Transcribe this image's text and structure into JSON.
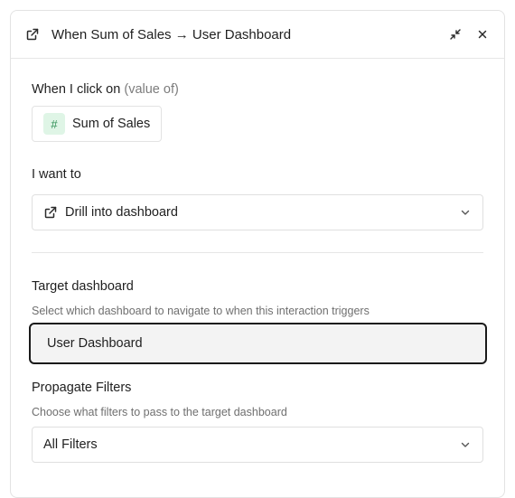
{
  "header": {
    "title": "When Sum of Sales → User Dashboard",
    "title_icon": "external-link-icon",
    "minimize_icon": "collapse-icon",
    "close_icon": "close-icon"
  },
  "trigger": {
    "label": "When I click on",
    "label_suffix": "(value of)",
    "chip_icon": "#",
    "chip_text": "Sum of Sales",
    "chip_color": "#dff5e6"
  },
  "action": {
    "label": "I want to",
    "selected": "Drill into dashboard",
    "icon": "external-link-icon"
  },
  "target": {
    "label": "Target dashboard",
    "help": "Select which dashboard to navigate to when this interaction triggers",
    "value": "User Dashboard"
  },
  "filters": {
    "label": "Propagate Filters",
    "help": "Choose what filters to pass to the target dashboard",
    "selected": "All Filters"
  }
}
